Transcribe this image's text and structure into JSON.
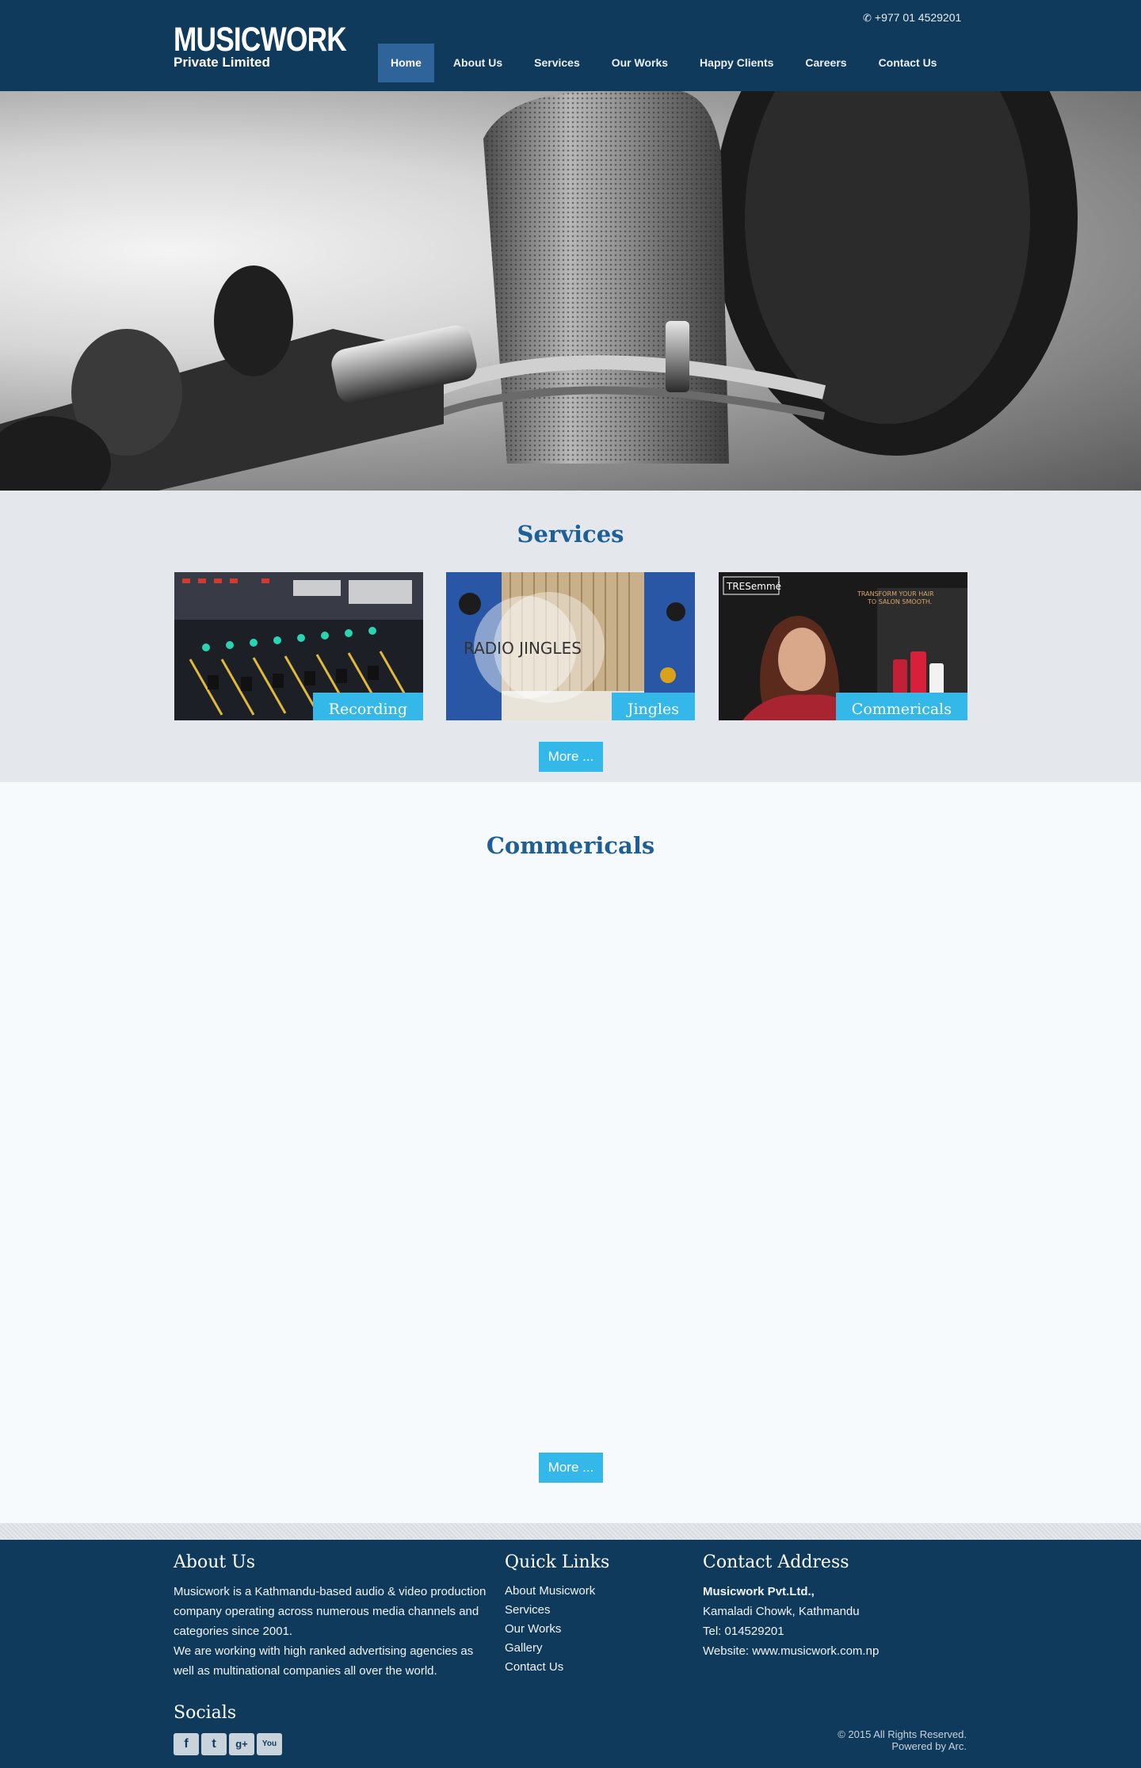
{
  "header": {
    "logo_main": "MUSICWORK",
    "logo_sub": "Private Limited",
    "phone": "+977 01 4529201",
    "nav": [
      {
        "label": "Home",
        "active": true
      },
      {
        "label": "About Us"
      },
      {
        "label": "Services"
      },
      {
        "label": "Our Works"
      },
      {
        "label": "Happy Clients"
      },
      {
        "label": "Careers"
      },
      {
        "label": "Contact Us"
      }
    ]
  },
  "services": {
    "title": "Services",
    "cards": [
      {
        "label": "Recording"
      },
      {
        "label": "Jingles",
        "image_text": "RADIO JINGLES"
      },
      {
        "label": "Commericals",
        "image_text": [
          "TRESemmé",
          "TRANSFORM YOUR HAIR",
          "TO SALON SMOOTH."
        ]
      }
    ],
    "more": "More ..."
  },
  "commercials": {
    "title": "Commericals",
    "more": "More ..."
  },
  "footer": {
    "about": {
      "title": "About Us",
      "p1": "Musicwork is a Kathmandu-based audio & video production company operating across numerous media channels and categories since 2001.",
      "p2": "We are working with high ranked advertising agencies as well as multinational companies all over the world."
    },
    "quick_links": {
      "title": "Quick Links",
      "links": [
        "About Musicwork",
        "Services",
        "Our Works",
        "Gallery",
        "Contact Us"
      ]
    },
    "contact": {
      "title": "Contact Address",
      "company": "Musicwork Pvt.Ltd.,",
      "address": "Kamaladi Chowk, Kathmandu",
      "tel": "Tel: 014529201",
      "website": "Website: www.musicwork.com.np"
    },
    "socials_title": "Socials",
    "socials": [
      {
        "icon": "facebook-icon",
        "glyph": "f"
      },
      {
        "icon": "twitter-icon",
        "glyph": "t"
      },
      {
        "icon": "google-plus-icon",
        "glyph": "g+"
      },
      {
        "icon": "youtube-icon",
        "glyph": "You"
      }
    ],
    "copyright": "© 2015 All Rights Reserved.",
    "powered": "Powered by Arc."
  },
  "colors": {
    "header_bg": "#0f3a5b",
    "nav_active": "#2e649a",
    "accent": "#34b8e9",
    "title_blue": "#1e5f95",
    "services_bg": "#e4e8ec"
  }
}
